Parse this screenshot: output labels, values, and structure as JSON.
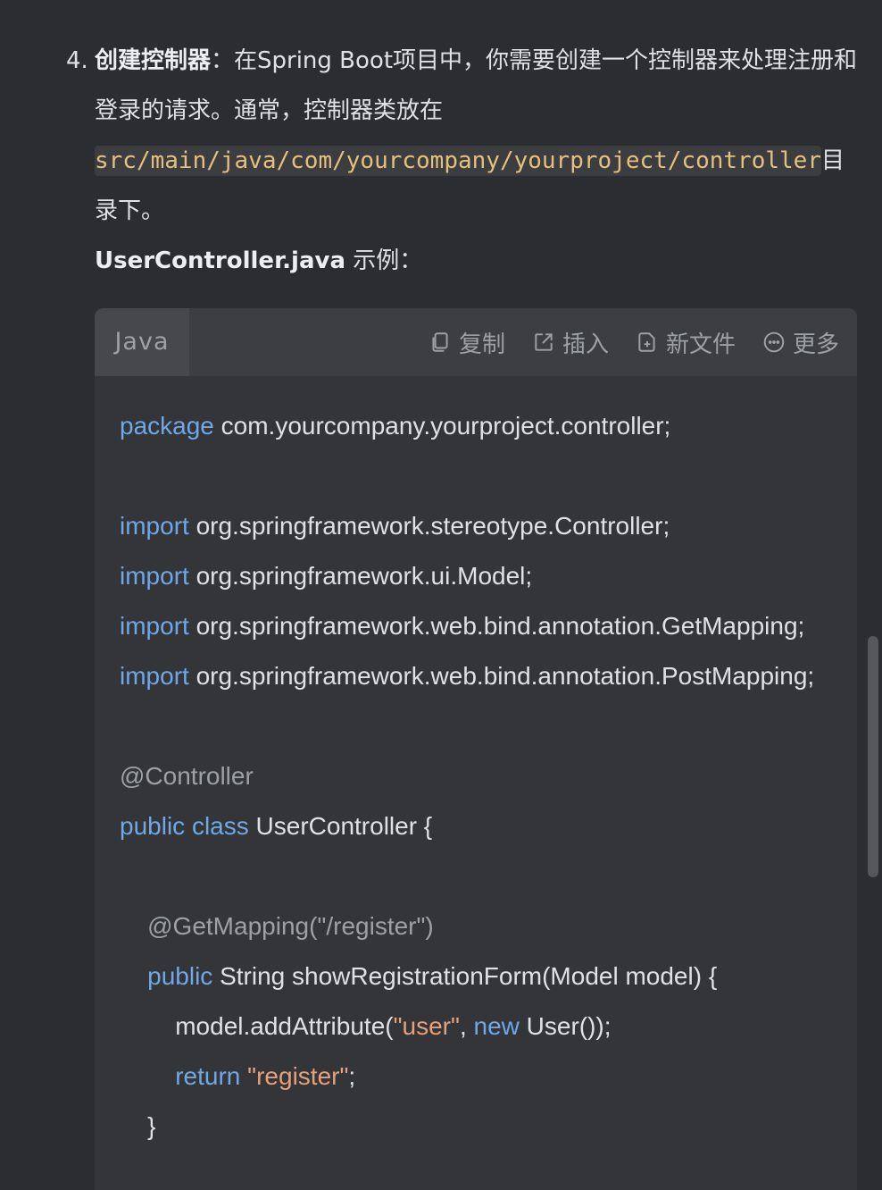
{
  "step": {
    "number": "4.",
    "title": "创建控制器",
    "text_line1": "：在Spring Boot项目中，你需要创建一个控制器来处理注册和登录的请求。通常，控制器类放在",
    "path": "src/main/java/com/yourcompany/yourproject/controller",
    "text_after_path": "目录下。",
    "example_file": "UserController.java",
    "example_suffix": " 示例："
  },
  "code_block": {
    "language": "Java",
    "actions": {
      "copy": "复制",
      "insert": "插入",
      "new_file": "新文件",
      "more": "更多"
    },
    "lines": [
      [
        {
          "t": "package",
          "c": "kw"
        },
        {
          "t": " com.yourcompany.yourproject.controller;",
          "c": ""
        }
      ],
      [],
      [
        {
          "t": "import",
          "c": "kw"
        },
        {
          "t": " org.springframework.stereotype.Controller;",
          "c": ""
        }
      ],
      [
        {
          "t": "import",
          "c": "kw"
        },
        {
          "t": " org.springframework.ui.Model;",
          "c": ""
        }
      ],
      [
        {
          "t": "import",
          "c": "kw"
        },
        {
          "t": " org.springframework.web.bind.annotation.GetMapping;",
          "c": ""
        }
      ],
      [
        {
          "t": "import",
          "c": "kw"
        },
        {
          "t": " org.springframework.web.bind.annotation.PostMapping;",
          "c": ""
        }
      ],
      [],
      [
        {
          "t": "@Controller",
          "c": "ann"
        }
      ],
      [
        {
          "t": "public",
          "c": "kw"
        },
        {
          "t": " ",
          "c": ""
        },
        {
          "t": "class",
          "c": "kw"
        },
        {
          "t": " UserController {",
          "c": ""
        }
      ],
      [],
      [
        {
          "t": "    ",
          "c": ""
        },
        {
          "t": "@GetMapping(\"/register\")",
          "c": "ann"
        }
      ],
      [
        {
          "t": "    ",
          "c": ""
        },
        {
          "t": "public",
          "c": "kw"
        },
        {
          "t": " String showRegistrationForm(Model model) {",
          "c": ""
        }
      ],
      [
        {
          "t": "        model.addAttribute(",
          "c": ""
        },
        {
          "t": "\"user\"",
          "c": "str"
        },
        {
          "t": ", ",
          "c": ""
        },
        {
          "t": "new",
          "c": "kw"
        },
        {
          "t": " User());",
          "c": ""
        }
      ],
      [
        {
          "t": "        ",
          "c": ""
        },
        {
          "t": "return",
          "c": "kw"
        },
        {
          "t": " ",
          "c": ""
        },
        {
          "t": "\"register\"",
          "c": "str"
        },
        {
          "t": ";",
          "c": ""
        }
      ],
      [
        {
          "t": "    }",
          "c": ""
        }
      ]
    ]
  },
  "colors": {
    "background": "#2b2d30",
    "keyword": "#6fa8e6",
    "annotation": "#9da0a5",
    "string": "#e6a07a",
    "inline_code": "#e6c07b"
  }
}
